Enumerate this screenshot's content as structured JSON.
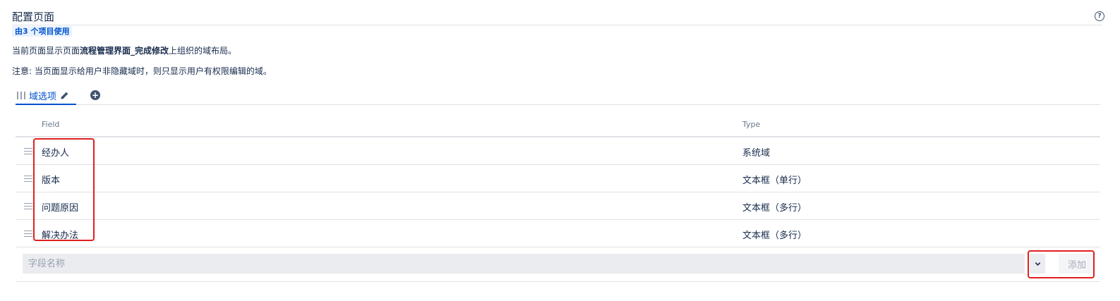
{
  "header": {
    "title": "配置页面",
    "help_icon": "help-icon",
    "usage_badge": "由3 个项目使用"
  },
  "description": {
    "line1_prefix": "当前页面显示页面",
    "line1_screen_name": "流程管理界面_完成修改",
    "line1_suffix": "上组织的域布局。",
    "line2": "注意: 当页面显示给用户非隐藏域时，则只显示用户有权限编辑的域。"
  },
  "tabs": [
    {
      "label": "域选项",
      "active": true,
      "icons": [
        "grip-icon",
        "pencil-icon"
      ]
    }
  ],
  "add_tab_icon": "plus-circle-icon",
  "table": {
    "columns": [
      "Field",
      "Type"
    ],
    "rows": [
      {
        "field": "经办人",
        "type": "系统域"
      },
      {
        "field": "版本",
        "type": "文本框（单行）"
      },
      {
        "field": "问题原因",
        "type": "文本框（多行）"
      },
      {
        "field": "解决办法",
        "type": "文本框（多行）"
      }
    ]
  },
  "add_field": {
    "placeholder": "字段名称",
    "value": "",
    "dropdown_icon": "chevron-down-icon",
    "button_label": "添加"
  },
  "colors": {
    "accent": "#0052cc",
    "highlight": "#e02020",
    "text": "#172b4d",
    "muted": "#6b778c"
  }
}
